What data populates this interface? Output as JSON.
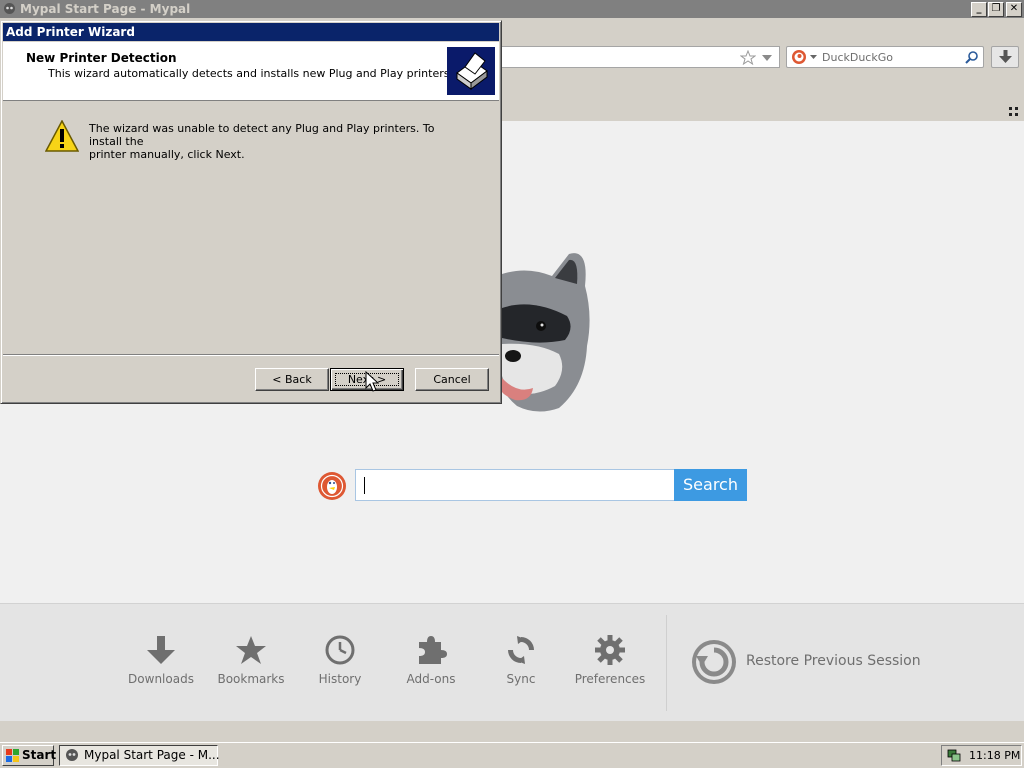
{
  "browser": {
    "window_title": "Mypal Start Page - Mypal",
    "search_placeholder": "DuckDuckGo",
    "search_engine_icon": "duckduckgo-icon"
  },
  "start_page": {
    "search_button_label": "Search",
    "launcher": [
      {
        "label": "Downloads",
        "icon": "download-icon"
      },
      {
        "label": "Bookmarks",
        "icon": "star-icon"
      },
      {
        "label": "History",
        "icon": "clock-icon"
      },
      {
        "label": "Add-ons",
        "icon": "puzzle-icon"
      },
      {
        "label": "Sync",
        "icon": "sync-icon"
      },
      {
        "label": "Preferences",
        "icon": "gear-icon"
      }
    ],
    "restore_label": "Restore Previous Session"
  },
  "wizard": {
    "title": "Add Printer Wizard",
    "heading": "New Printer Detection",
    "subheading": "This wizard automatically detects and installs new Plug and Play printers.",
    "message_line1": "The wizard was unable to detect any Plug and Play printers. To install the",
    "message_line2": "printer manually, click Next.",
    "back_label": "< Back",
    "next_label": "Next >",
    "cancel_label": "Cancel"
  },
  "taskbar": {
    "start_label": "Start",
    "task_label": "Mypal Start Page - M...",
    "clock": "11:18 PM"
  },
  "colors": {
    "title_active": "#0a246a",
    "search_button": "#3d9ae2",
    "ddg_orange": "#de5833"
  }
}
